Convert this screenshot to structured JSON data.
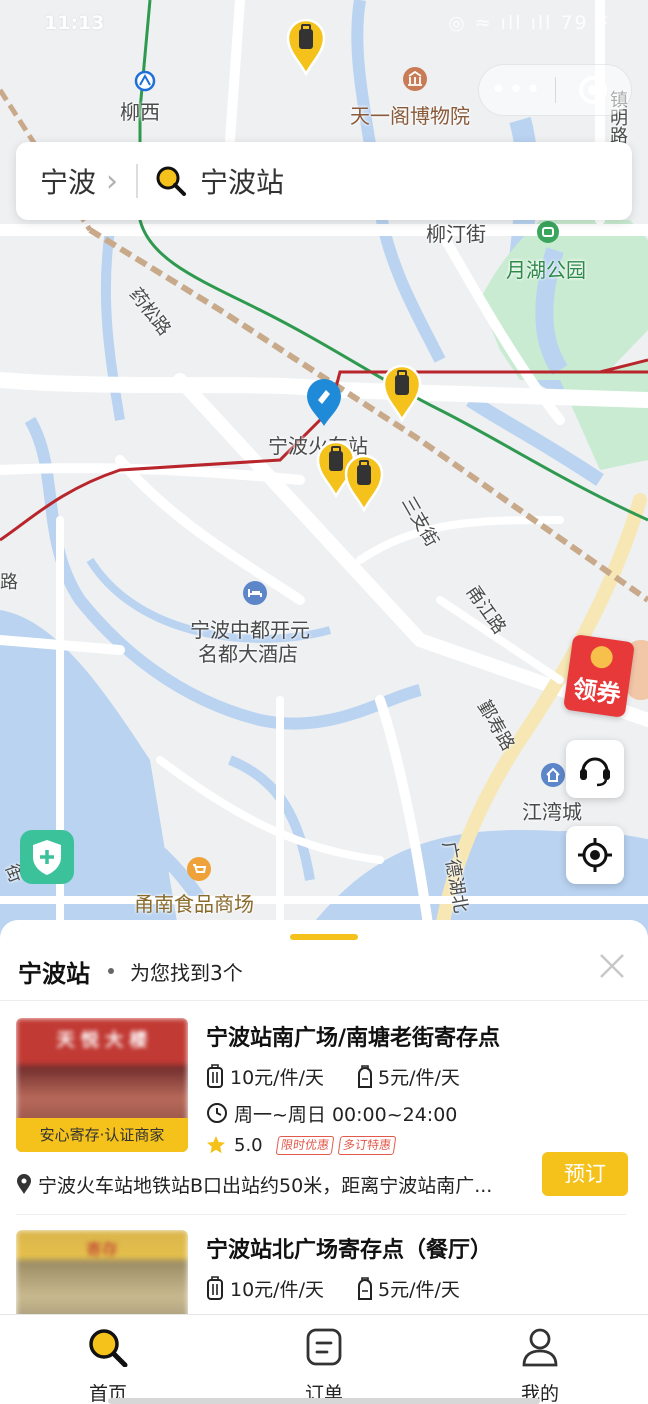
{
  "status_bar": {
    "time": "11:13",
    "right": "◎ ≈ ıll ıll 79 ⚡"
  },
  "capsule": {
    "more_label": "•••"
  },
  "search": {
    "city": "宁波",
    "chevron": "›",
    "query": "宁波站"
  },
  "map_labels": {
    "station_liuxi": "柳西",
    "museum": "天一阁博物院",
    "street_liuting": "柳汀街",
    "park_yuehu": "月湖公园",
    "road_yaosong": "药松路",
    "station_ningbo": "宁波火车站",
    "road_sanzhi": "三支街",
    "road_yangjiang": "甬江路",
    "hotel_line1": "宁波中都开元",
    "hotel_line2": "名都大酒店",
    "road_yinshou": "鄞寿路",
    "community_jiangwan": "江湾城",
    "road_guangde": "广德湖北",
    "market": "甬南食品商场",
    "road_zhen": "镇明路",
    "road_left": "路",
    "road_left2": "街"
  },
  "coupon": {
    "label": "领券"
  },
  "sheet": {
    "title": "宁波站",
    "result_text": "为您找到3个"
  },
  "results": [
    {
      "name": "宁波站南广场/南塘老街寄存点",
      "badge": "安心寄存·认证商家",
      "price_luggage": "10元/件/天",
      "price_bag": "5元/件/天",
      "hours": "周一~周日 00:00~24:00",
      "rating": "5.0",
      "tags": [
        "限时优惠",
        "多订特惠"
      ],
      "address": "宁波火车站地铁站B口出站约50米，距离宁波站南广...",
      "book_label": "预订",
      "thumb_text": "天  悦  大  楼"
    },
    {
      "name": "宁波站北广场寄存点（餐厅）",
      "price_luggage": "10元/件/天",
      "price_bag": "5元/件/天",
      "thumb_text": "寄存"
    }
  ],
  "tabbar": [
    {
      "label": "首页",
      "icon": "search-icon",
      "active": true
    },
    {
      "label": "订单",
      "icon": "order-icon",
      "active": false
    },
    {
      "label": "我的",
      "icon": "profile-icon",
      "active": false
    }
  ],
  "colors": {
    "brand": "#f4c21a",
    "shield": "#3cc29a",
    "coupon": "#e8393a",
    "pin_blue": "#1f8ad8"
  }
}
